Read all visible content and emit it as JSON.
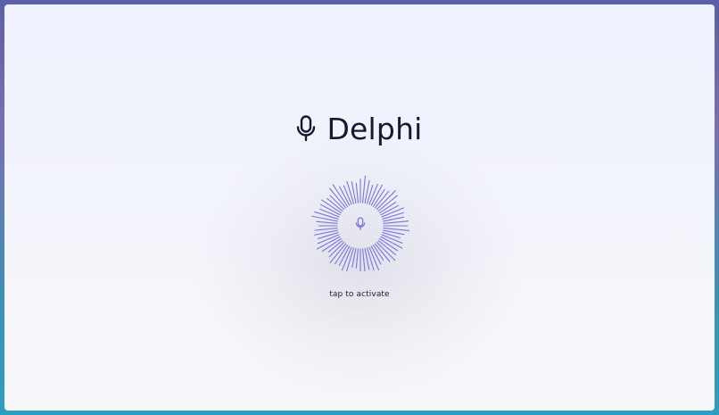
{
  "app": {
    "title": "Delphi",
    "title_icon": "microphone-icon"
  },
  "activation": {
    "button_icon": "microphone-icon",
    "caption": "tap to activate"
  },
  "colors": {
    "accent": "#7a74de",
    "title_text": "#161a2e",
    "caption_text": "#1c1e2a"
  }
}
